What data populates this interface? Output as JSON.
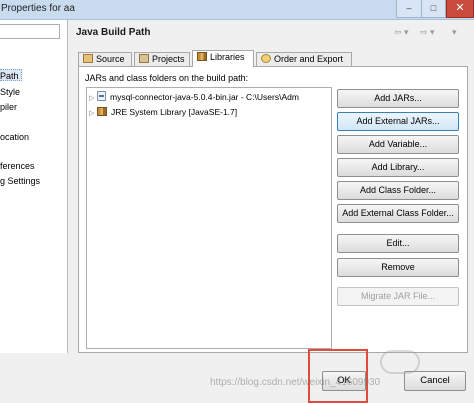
{
  "window": {
    "title": "Properties for aa",
    "close_glyph": "✕"
  },
  "left_pane": {
    "items": [
      "Path",
      "Style",
      "piler",
      "ocation",
      "ferences",
      "g Settings"
    ]
  },
  "page": {
    "title": "Java Build Path",
    "nav_back": "⇦ ▾",
    "nav_fwd": "⇨ ▾",
    "menu": "▾"
  },
  "tabs": [
    {
      "label": "Source"
    },
    {
      "label": "Projects"
    },
    {
      "label": "Libraries"
    },
    {
      "label": "Order and Export"
    }
  ],
  "panel": {
    "label": "JARs and class folders on the build path:",
    "entries": [
      {
        "label": "mysql-connector-java-5.0.4-bin.jar - C:\\Users\\Adm"
      },
      {
        "label": "JRE System Library [JavaSE-1.7]"
      }
    ]
  },
  "buttons": {
    "add_jars": "Add JARs...",
    "add_external_jars": "Add External JARs...",
    "add_variable": "Add Variable...",
    "add_library": "Add Library...",
    "add_class_folder": "Add Class Folder...",
    "add_external_class_folder": "Add External Class Folder...",
    "edit": "Edit...",
    "remove": "Remove",
    "migrate": "Migrate JAR File..."
  },
  "footer": {
    "ok": "OK",
    "cancel": "Cancel"
  },
  "watermark": {
    "text": "https://blog.csdn.net/weixin_41609930"
  },
  "colors": {
    "accent_border": "#e04b3c",
    "selected_tab_bg": "#ffffff",
    "focused_button_border": "#3c7fb1"
  }
}
